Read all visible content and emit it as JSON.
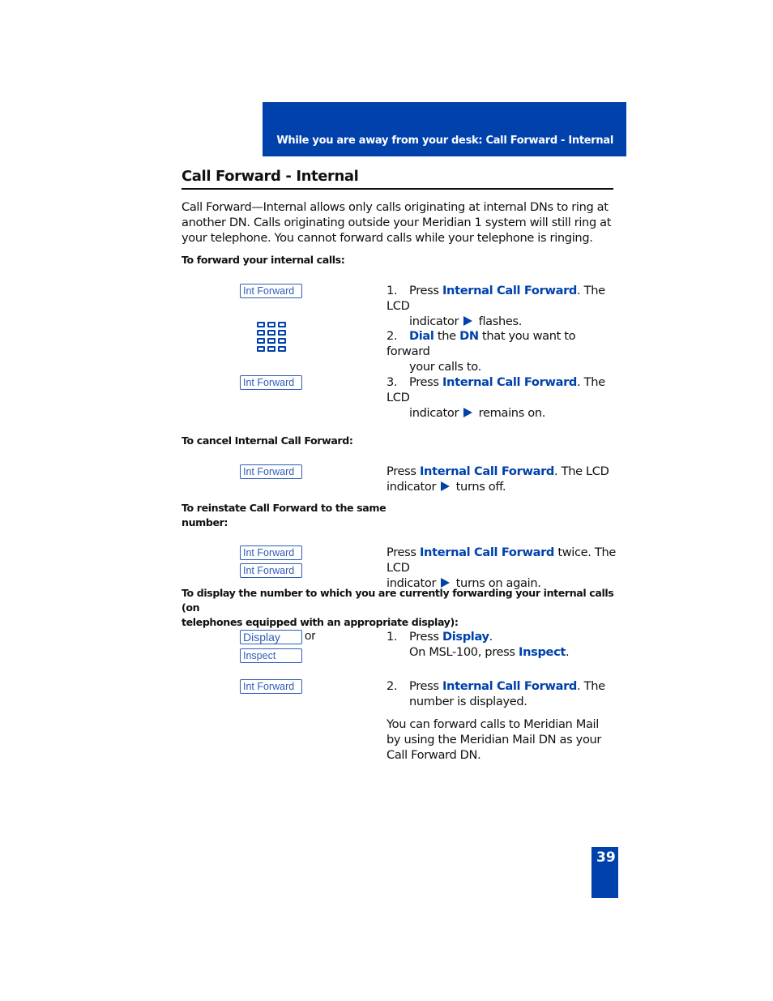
{
  "header": {
    "running_head": "While you are away from your desk: Call Forward - Internal",
    "color": "#0041ac"
  },
  "title": "Call Forward - Internal",
  "intro": "Call Forward—Internal allows only calls originating at internal DNs to ring at another DN. Calls originating outside your Meridian 1 system will still ring at your telephone. You cannot forward calls while your telephone is ringing.",
  "sections": {
    "forward": {
      "heading": "To forward your internal calls:",
      "key1": "Int Forward",
      "keypad_icon": "dialpad-icon",
      "key3": "Int Forward",
      "step1": {
        "num": "1.",
        "pre": "Press ",
        "hl": "Internal Call Forward",
        "post": ". The LCD",
        "line2_pre": "indicator ",
        "line2_post": " flashes."
      },
      "step2": {
        "num": "2.",
        "hl1": "Dial",
        "mid": " the ",
        "hl2": "DN",
        "post": " that you want to forward",
        "line2": "your calls to."
      },
      "step3": {
        "num": "3.",
        "pre": "Press ",
        "hl": "Internal Call Forward",
        "post": ". The LCD",
        "line2_pre": "indicator ",
        "line2_post": " remains on."
      }
    },
    "cancel": {
      "heading": "To cancel Internal Call Forward:",
      "key": "Int Forward",
      "text": {
        "pre": "Press ",
        "hl": "Internal Call Forward",
        "post": ". The LCD",
        "line2_pre": "indicator ",
        "line2_post": " turns off."
      }
    },
    "reinstate": {
      "heading_line1": "To reinstate Call Forward to the same",
      "heading_line2": "number:",
      "key1": "Int Forward",
      "key2": "Int Forward",
      "text": {
        "pre": "Press ",
        "hl": "Internal Call Forward",
        "post": " twice. The LCD",
        "line2_pre": "indicator ",
        "line2_post": " turns on again."
      }
    },
    "display": {
      "heading_line1": "To display the number to which you are currently forwarding your internal calls (on",
      "heading_line2": "telephones equipped with an appropriate display):",
      "key_display": "Display",
      "or": "or",
      "key_inspect": "Inspect",
      "key_forward": "Int Forward",
      "step1": {
        "num": "1.",
        "pre": "Press ",
        "hl": "Display",
        "post": ".",
        "line2_pre": "On MSL-100, press ",
        "line2_hl": "Inspect",
        "line2_post": "."
      },
      "step2": {
        "num": "2.",
        "pre": "Press ",
        "hl": "Internal Call Forward",
        "post": ". The",
        "line2": "number is displayed."
      },
      "note": "You can forward calls to Meridian Mail by using the Meridian Mail DN as your Call Forward DN."
    }
  },
  "page_number": "39"
}
